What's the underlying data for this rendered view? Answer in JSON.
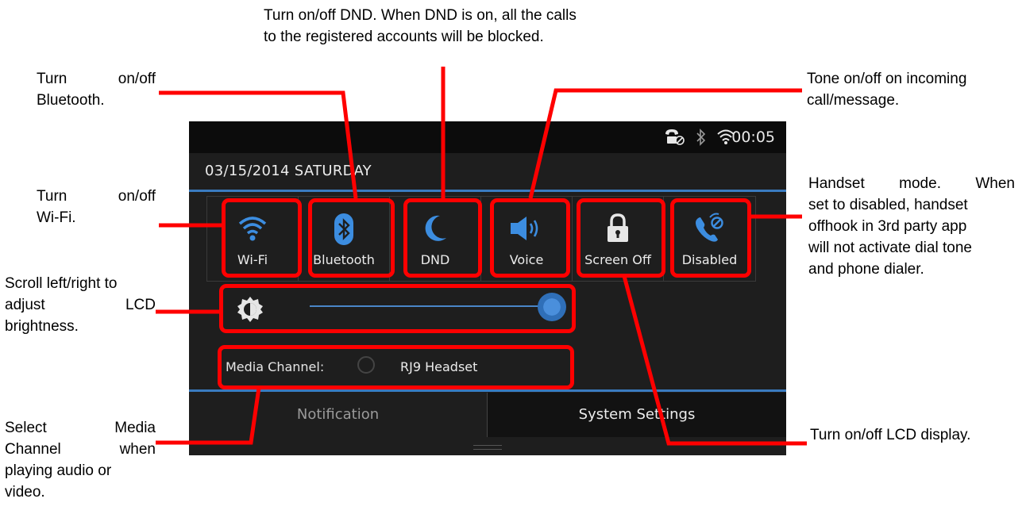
{
  "callouts": {
    "dnd_line1": "Turn on/off DND. When DND is on, all the calls",
    "dnd_line2": "to the registered accounts will be blocked.",
    "bluetooth_line1": "Turn on/off",
    "bluetooth_line2": "Bluetooth.",
    "wifi_line1": "Turn on/off",
    "wifi_line2": "Wi-Fi.",
    "brightness_line1": "Scroll left/right to",
    "brightness_line2": "adjust LCD",
    "brightness_line3": "brightness.",
    "media_line1": "Select Media",
    "media_line2": "Channel when",
    "media_line3": "playing audio or",
    "media_line4": "video.",
    "tone_line1": "Tone on/off on incoming",
    "tone_line2": "call/message.",
    "handset_line1": "Handset mode. When",
    "handset_line2": "set to disabled, handset",
    "handset_line3": "offhook in 3rd party app",
    "handset_line4": "will not activate dial tone",
    "handset_line5": "and phone dialer.",
    "lcd": "Turn on/off LCD display."
  },
  "status": {
    "time": "00:05",
    "icons": [
      "handset-disabled-icon",
      "bluetooth-icon",
      "wifi-icon"
    ]
  },
  "date": "03/15/2014 SATURDAY",
  "tiles": [
    {
      "label": "Wi-Fi",
      "icon": "wifi-icon"
    },
    {
      "label": "Bluetooth",
      "icon": "bluetooth-icon"
    },
    {
      "label": "DND",
      "icon": "moon-icon"
    },
    {
      "label": "Voice",
      "icon": "speaker-icon"
    },
    {
      "label": "Screen Off",
      "icon": "lock-icon"
    },
    {
      "label": "Disabled",
      "icon": "handset-disabled-icon"
    }
  ],
  "brightness": {
    "icon": "brightness-icon",
    "level": 0.95
  },
  "media": {
    "label": "Media Channel:",
    "value": "RJ9 Headset"
  },
  "tabs": [
    {
      "label": "Notification",
      "active": false
    },
    {
      "label": "System Settings",
      "active": true
    }
  ],
  "colors": {
    "highlight": "#ff0000",
    "accent": "#3a7bc0",
    "icon_blue": "#3c8de0"
  }
}
